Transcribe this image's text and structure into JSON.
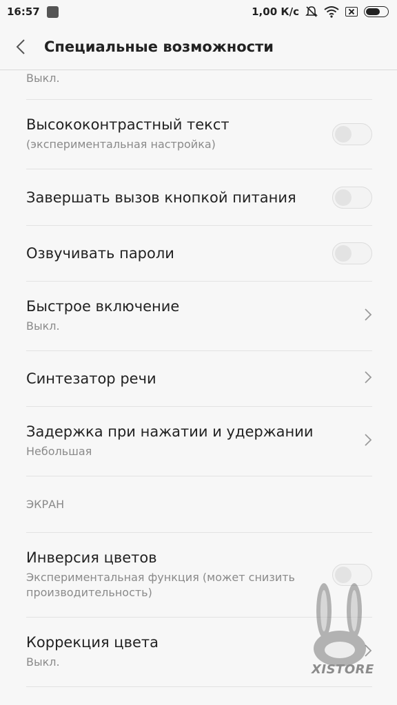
{
  "status_bar": {
    "time": "16:57",
    "speed": "1,00 К/с",
    "icons": [
      "app-icon",
      "silent-icon",
      "wifi-icon",
      "sim-icon",
      "battery-icon"
    ]
  },
  "header": {
    "title": "Специальные возможности"
  },
  "partial_row": {
    "subtitle": "Выкл."
  },
  "rows": {
    "high_contrast": {
      "title": "Высококонтрастный текст",
      "subtitle": "(экспериментальная настройка)",
      "toggle": "off"
    },
    "end_call_power": {
      "title": "Завершать вызов кнопкой питания",
      "toggle": "off"
    },
    "speak_passwords": {
      "title": "Озвучивать пароли",
      "toggle": "off"
    },
    "quick_enable": {
      "title": "Быстрое включение",
      "subtitle": "Выкл."
    },
    "tts": {
      "title": "Синтезатор речи"
    },
    "touch_hold_delay": {
      "title": "Задержка при нажатии и удержании",
      "subtitle": "Небольшая"
    }
  },
  "section": {
    "label": "ЭКРАН"
  },
  "screen_rows": {
    "color_inversion": {
      "title": "Инверсия цветов",
      "subtitle": "Экспериментальная функция (может снизить производительность)",
      "toggle": "off"
    },
    "color_correction": {
      "title": "Коррекция цвета",
      "subtitle": "Выкл."
    }
  },
  "watermark": {
    "text": "XISTORE"
  },
  "colors": {
    "background": "#f7f7f7",
    "text": "#222222",
    "secondary": "#8a8a8a",
    "divider": "#e2e2e2"
  }
}
